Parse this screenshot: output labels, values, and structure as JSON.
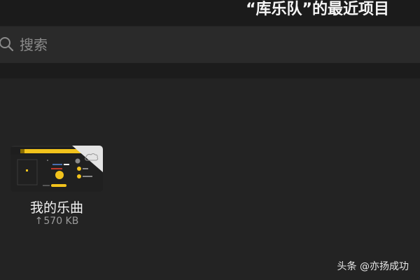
{
  "header": {
    "title": "“库乐队”的最近项目"
  },
  "search": {
    "placeholder": "搜索",
    "value": ""
  },
  "files": [
    {
      "name": "我的乐曲",
      "size": "570 KB",
      "upload_icon": "↑"
    }
  ],
  "watermark": "头条 @亦扬成功",
  "colors": {
    "background": "#232323",
    "header_bar": "#1b1b1b",
    "search_bar": "#2a2a2a",
    "accent_yellow": "#f2c31c",
    "secondary_text": "#9a9a9a"
  },
  "icons": {
    "search": "search-icon",
    "upload": "upload-arrow-icon",
    "cloud": "cloud-icon"
  }
}
